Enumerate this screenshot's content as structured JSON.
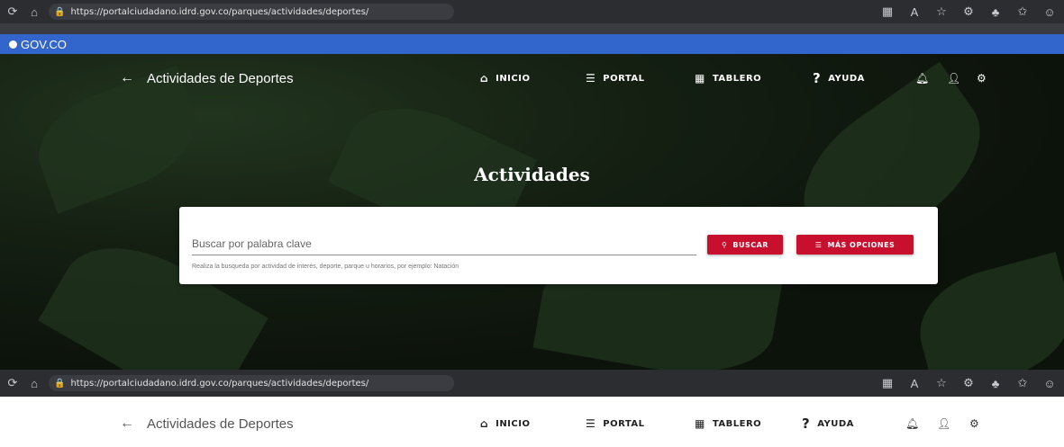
{
  "browser": {
    "url": "https://portalciudadano.idrd.gov.co/parques/actividades/deportes/",
    "icons": [
      "refresh-icon",
      "home-icon",
      "lock-icon",
      "grid-icon",
      "read-icon",
      "star-icon",
      "extensions-icon",
      "profile-icon",
      "favorites-icon",
      "account-icon"
    ]
  },
  "gov_bar": {
    "label": "GOV.CO"
  },
  "nav": {
    "back_label": "Actividades de Deportes",
    "inicio": "INICIO",
    "portal": "PORTAL",
    "tablero": "TABLERO",
    "ayuda": "AYUDA"
  },
  "hero": {
    "title": "Actividades"
  },
  "search": {
    "placeholder": "Buscar por palabra clave",
    "hint": "Realiza la busqueda por actividad de interés, deporte, parque u horarios, por ejemplo: Natación",
    "search_button": "BUSCAR",
    "more_button": "MÁS OPCIONES"
  },
  "colors": {
    "accent": "#c8102e",
    "gov_blue": "#3366cc",
    "browser_bar": "#2b2d31"
  }
}
